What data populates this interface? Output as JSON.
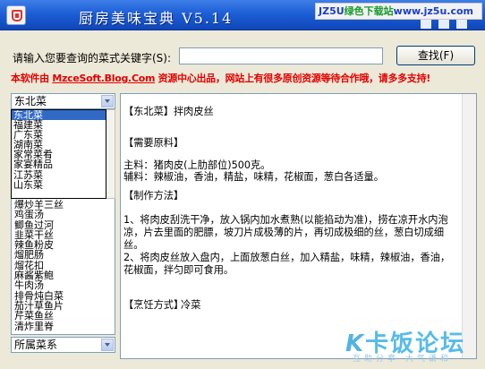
{
  "titlebar": {
    "title": "厨房美味宝典 V5.14",
    "brand_part1": "JZ5U",
    "brand_part2": "绿色下载站",
    "brand_part3": "www.jz5u.com"
  },
  "search": {
    "label": "请输入您要查询的菜式关键字(S):",
    "value": "",
    "button_label": "查找(F)"
  },
  "notice": {
    "prefix": "本软件由 ",
    "link_text": "MzceSoft.Blog.Com",
    "suffix": " 资源中心出品，网站上有很多原创资源等待合作哦，请多多支持!"
  },
  "category_select": {
    "value": "东北菜",
    "options": [
      "东北菜",
      "福建菜",
      "广东菜",
      "湖南菜",
      "家常菜肴",
      "家宴精品",
      "江苏菜",
      "山东菜"
    ]
  },
  "dish_list": {
    "items": [
      "爆炒羊三丝",
      "鸡蛋汤",
      "鲫鱼过河",
      "韭菜干丝",
      "辣鱼粉皮",
      "熘肥肠",
      "熘花扣",
      "麻酱紫鲍",
      "牛肉汤",
      "排骨炖白菜",
      "茄汁草鱼片",
      "芹菜鱼丝",
      "清炸里脊"
    ]
  },
  "type_select": {
    "value": "所属菜系"
  },
  "content": {
    "title_line": "【东北菜】拌肉皮丝",
    "section_ingredients": "【需要原料】",
    "ingredients_main": "主料：猪肉皮(上肋部位)500克。",
    "ingredients_aux": "辅料：辣椒油，香油，精盐，味精，花椒面，葱白各适量。",
    "section_method": "【制作方法】",
    "method_1": "1、将肉皮刮洗干净，放入锅内加水煮熟(以能掐动为准)，捞在凉开水内泡凉，片去里面的肥膘，坡刀片成极薄的片，再切成极细的丝，葱白切成细丝。",
    "method_2": "2、将肉皮丝放入盘内，上面放葱白丝，加入精盐，味精，辣椒油，香油，花椒面，拌匀即可食用。",
    "section_style": "【烹饪方式】",
    "style_value": "冷菜"
  },
  "watermark": {
    "logo_k": "K",
    "logo_text": "卡饭论坛",
    "subtitle": "互助分享  大气谦和"
  },
  "colors": {
    "titlebar": "#1d5fd6",
    "notice": "#e30000",
    "selection": "#316ac5",
    "brand_green": "#159b2a",
    "brand_blue": "#1a3fc8"
  },
  "icons": {
    "app": "cooking-pot-icon",
    "dropdown": "chevron-down-icon"
  }
}
